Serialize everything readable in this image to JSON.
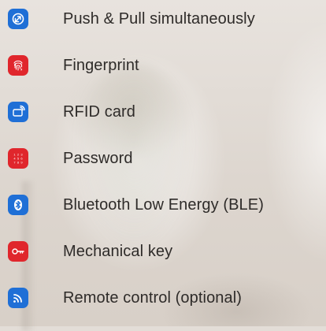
{
  "features": [
    {
      "label": "Push & Pull simultaneously",
      "icon": "push-pull-icon",
      "color": "#1f6fd6"
    },
    {
      "label": "Fingerprint",
      "icon": "fingerprint-icon",
      "color": "#e0262c"
    },
    {
      "label": "RFID card",
      "icon": "rfid-card-icon",
      "color": "#1f6fd6"
    },
    {
      "label": "Password",
      "icon": "keypad-icon",
      "color": "#e0262c"
    },
    {
      "label": "Bluetooth Low Energy (BLE)",
      "icon": "bluetooth-icon",
      "color": "#1f6fd6"
    },
    {
      "label": "Mechanical key",
      "icon": "key-icon",
      "color": "#e0262c"
    },
    {
      "label": "Remote control (optional)",
      "icon": "remote-signal-icon",
      "color": "#1f6fd6"
    }
  ]
}
